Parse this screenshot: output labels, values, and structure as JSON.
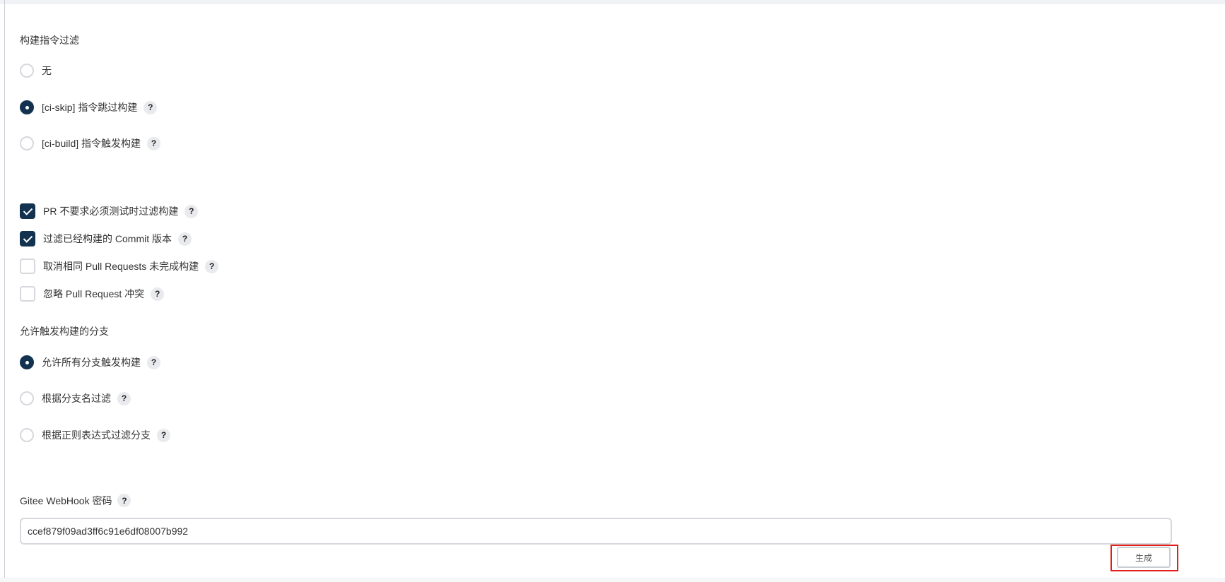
{
  "build_filter": {
    "label": "构建指令过滤",
    "options": [
      {
        "label": "无",
        "selected": false,
        "has_help": false
      },
      {
        "label": "[ci-skip] 指令跳过构建",
        "selected": true,
        "has_help": true
      },
      {
        "label": "[ci-build] 指令触发构建",
        "selected": false,
        "has_help": true
      }
    ]
  },
  "checkboxes": [
    {
      "label": "PR 不要求必须测试时过滤构建",
      "checked": true
    },
    {
      "label": "过滤已经构建的 Commit 版本",
      "checked": true
    },
    {
      "label": "取消相同 Pull Requests 未完成构建",
      "checked": false
    },
    {
      "label": "忽略 Pull Request 冲突",
      "checked": false
    }
  ],
  "branch_filter": {
    "label": "允许触发构建的分支",
    "options": [
      {
        "label": "允许所有分支触发构建",
        "selected": true
      },
      {
        "label": "根据分支名过滤",
        "selected": false
      },
      {
        "label": "根据正则表达式过滤分支",
        "selected": false
      }
    ]
  },
  "webhook_secret": {
    "label": "Gitee WebHook 密码",
    "value": "ccef879f09ad3ff6c91e6df08007b992"
  },
  "generate_button": {
    "label": "生成"
  },
  "help_glyph": "?",
  "colors": {
    "accent": "#12324f",
    "highlight": "#e0201a",
    "border": "#d6d8dd",
    "help_bg": "#e9eaed"
  },
  "icons": {
    "help": "question-mark-icon"
  }
}
